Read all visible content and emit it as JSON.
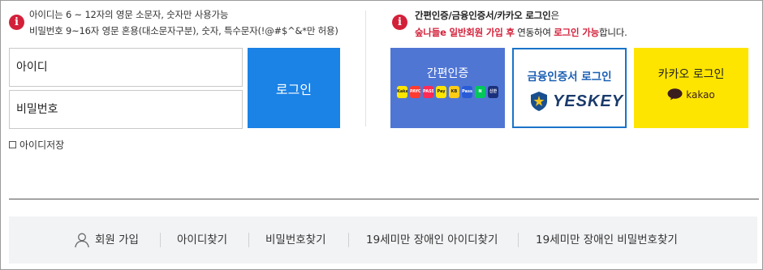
{
  "notice_left": {
    "line1": "아이디는 6 ~ 12자의 영문 소문자, 숫자만 사용가능",
    "line2": "비밀번호 9~16자 영문 혼용(대소문자구분), 숫자, 특수문자(!@#$^&*만 허용)"
  },
  "login_form": {
    "id_placeholder": "아이디",
    "password_placeholder": "비밀번호",
    "login_button": "로그인",
    "save_id_label": "아이디저장"
  },
  "notice_right": {
    "line1": "간편인증/금융인증서/카카오 로그인",
    "line1_suffix": "은",
    "line2_red": "숲나들e 일반회원 가입 후",
    "line2_mid": " 연동하여 ",
    "line2_red2": "로그인 가능",
    "line2_end": "합니다."
  },
  "tiles": {
    "simple_auth": "간편인증",
    "simple_auth_chips": [
      {
        "text": "Kakao",
        "color": "#fee500"
      },
      {
        "text": "PAYCO",
        "color": "#ff3b30"
      },
      {
        "text": "PASS",
        "color": "#ff2a55"
      },
      {
        "text": "Pay",
        "color": "#fee500"
      },
      {
        "text": "KB",
        "color": "#fccc15"
      },
      {
        "text": "Pass",
        "color": "#2a5bd7"
      },
      {
        "text": "N",
        "color": "#03c75a"
      },
      {
        "text": "신한",
        "color": "#1b2f7a"
      }
    ],
    "financial_cert": "금융인증서 로그인",
    "yeskey": "YESKEY",
    "kakao_login": "카카오 로그인",
    "kakao_brand": "kakao"
  },
  "footer_links": [
    "회원 가입",
    "아이디찾기",
    "비밀번호찾기",
    "19세미만 장애인 아이디찾기",
    "19세미만 장애인 비밀번호찾기"
  ],
  "colors": {
    "accent_blue": "#1b82e6",
    "alert_red": "#d3203a",
    "kakao_yellow": "#fee500",
    "simple_blue": "#5076d4"
  }
}
